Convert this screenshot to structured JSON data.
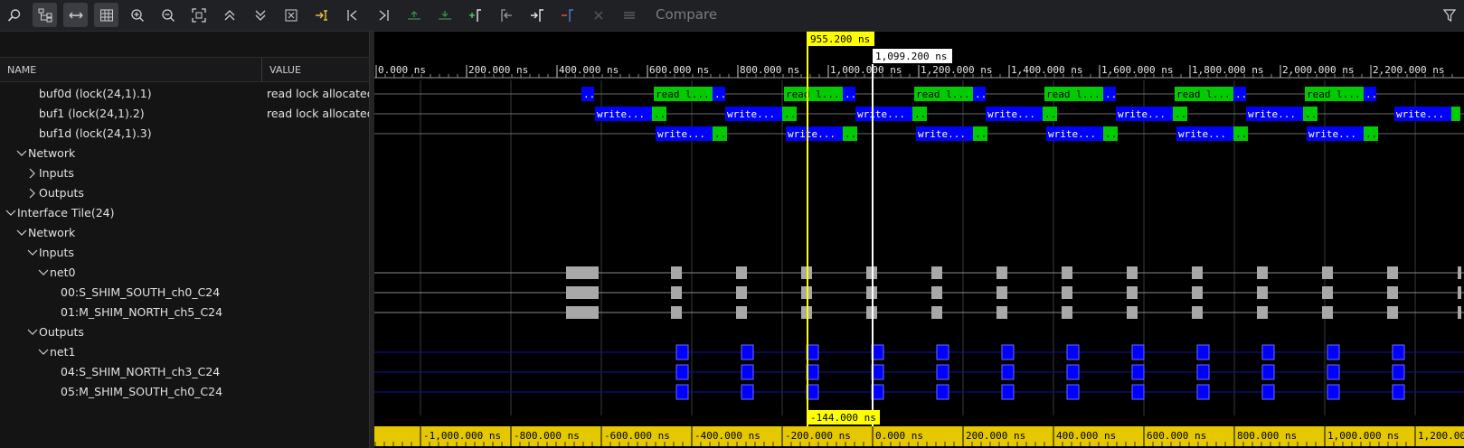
{
  "toolbar": {
    "compare_label": "Compare",
    "icons": [
      "search-icon",
      "hierarchy-icon",
      "fit-width-icon",
      "grid-icon",
      "zoom-in-icon",
      "zoom-out-icon",
      "zoom-fit-icon",
      "collapse-all-icon",
      "expand-all-icon",
      "close-signal-icon",
      "goto-start-icon",
      "previous-edge-icon",
      "next-edge-icon",
      "move-up-icon",
      "move-down-icon",
      "add-marker-icon",
      "previous-marker-icon",
      "next-marker-icon",
      "remove-marker-icon",
      "clear-icon",
      "list-icon",
      "filter-icon"
    ]
  },
  "signal_list": {
    "headers": {
      "name": "NAME",
      "value": "VALUE"
    },
    "rows": [
      {
        "label": "buf0d (lock(24,1).1)",
        "value": "read lock allocated",
        "indent": 0,
        "chevron": ""
      },
      {
        "label": "buf1 (lock(24,1).2)",
        "value": "read lock allocated",
        "indent": 0,
        "chevron": ""
      },
      {
        "label": "buf1d (lock(24,1).3)",
        "value": "",
        "indent": 0,
        "chevron": ""
      },
      {
        "label": "Network",
        "value": "",
        "indent": -1,
        "chevron": "down"
      },
      {
        "label": "Inputs",
        "value": "",
        "indent": 0,
        "chevron": "right"
      },
      {
        "label": "Outputs",
        "value": "",
        "indent": 0,
        "chevron": "right"
      },
      {
        "label": "Interface Tile(24)",
        "value": "",
        "indent": -2,
        "chevron": "down"
      },
      {
        "label": "Network",
        "value": "",
        "indent": -1,
        "chevron": "down"
      },
      {
        "label": "Inputs",
        "value": "",
        "indent": 0,
        "chevron": "down"
      },
      {
        "label": "net0",
        "value": "",
        "indent": 1,
        "chevron": "down"
      },
      {
        "label": "00:S_SHIM_SOUTH_ch0_C24",
        "value": "",
        "indent": 2,
        "chevron": ""
      },
      {
        "label": "01:M_SHIM_NORTH_ch5_C24",
        "value": "",
        "indent": 2,
        "chevron": ""
      },
      {
        "label": "Outputs",
        "value": "",
        "indent": 0,
        "chevron": "down"
      },
      {
        "label": "net1",
        "value": "",
        "indent": 1,
        "chevron": "down"
      },
      {
        "label": "04:S_SHIM_NORTH_ch3_C24",
        "value": "",
        "indent": 2,
        "chevron": ""
      },
      {
        "label": "05:M_SHIM_SOUTH_ch0_C24",
        "value": "",
        "indent": 2,
        "chevron": ""
      }
    ]
  },
  "ruler": {
    "labels": [
      "0.000 ns",
      "200.000 ns",
      "400.000 ns",
      "600.000 ns",
      "800.000 ns",
      "1,000.000 ns",
      "1,200.000 ns",
      "1,400.000 ns",
      "1,600.000 ns",
      "1,800.000 ns",
      "2,000.000 ns",
      "2,200.000 ns"
    ]
  },
  "cursors": {
    "primary_label": "955.200 ns",
    "secondary_label": "1,099.200 ns",
    "delta_label": "-144.000 ns"
  },
  "bottom_ruler": {
    "labels": [
      "-1,000.000 ns",
      "-800.000 ns",
      "-600.000 ns",
      "-400.000 ns",
      "-200.000 ns",
      "0.000 ns",
      "200.000 ns",
      "400.000 ns",
      "600.000 ns",
      "800.000 ns",
      "1,000.000 ns",
      "1,200.000 ns"
    ]
  },
  "wave_text": {
    "read_label": "read l...",
    "write_label": "write...",
    "dots_label": ".."
  },
  "colors": {
    "write": "#0000ff",
    "read": "#00cc00",
    "cursor": "#ffff00",
    "idle_packet": "#a8a8a8",
    "blue_line": "#1010a8"
  }
}
